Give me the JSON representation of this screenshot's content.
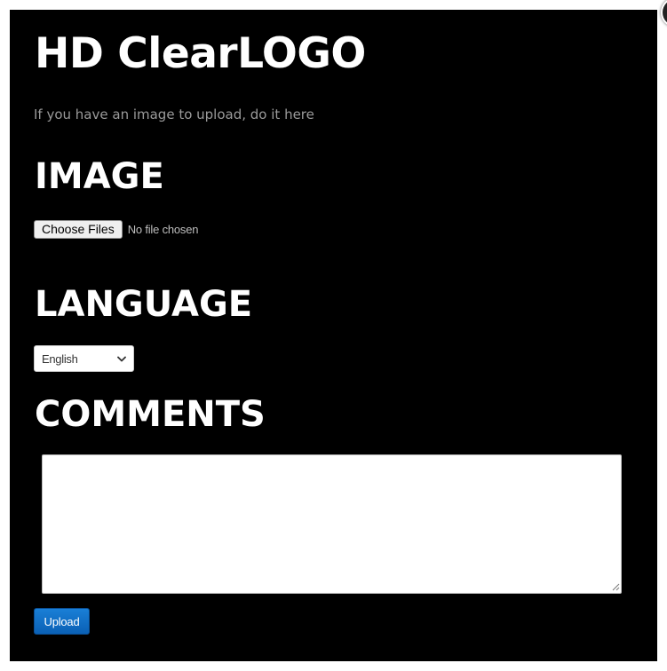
{
  "dialog": {
    "title": "HD ClearLOGO",
    "subtitle": "If you have an image to upload, do it here",
    "close_icon": "close-icon"
  },
  "image_section": {
    "heading": "IMAGE",
    "choose_button_label": "Choose Files",
    "file_status": "No file chosen"
  },
  "language_section": {
    "heading": "LANGUAGE",
    "selected": "English",
    "dropdown_icon": "chevron-down-icon"
  },
  "comments_section": {
    "heading": "COMMENTS",
    "value": ""
  },
  "actions": {
    "upload_label": "Upload"
  },
  "colors": {
    "background": "#000000",
    "heading_text": "#ffffff",
    "subtitle_text": "#9a9a9a",
    "upload_button": "#0a6cc4"
  }
}
